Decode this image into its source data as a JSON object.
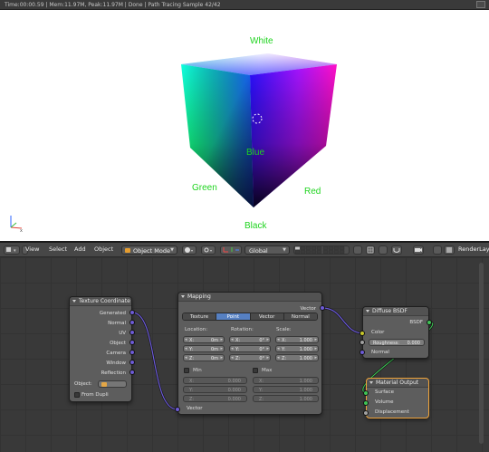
{
  "statusbar": {
    "text": "Time:00:00.59 | Mem:11.97M, Peak:11.97M | Done | Path Tracing Sample 42/42"
  },
  "viewport": {
    "labels": {
      "white": "White",
      "blue": "Blue",
      "green": "Green",
      "red": "Red",
      "black": "Black"
    },
    "label_color": "#1fd41f"
  },
  "header": {
    "menu": {
      "view": "View",
      "select": "Select",
      "add": "Add",
      "object": "Object"
    },
    "mode": "Object Mode",
    "orientation": "Global",
    "layer": "RenderLayer"
  },
  "nodes": {
    "texcoord": {
      "title": "Texture Coordinate",
      "outputs": [
        "Generated",
        "Normal",
        "UV",
        "Object",
        "Camera",
        "Window",
        "Reflection"
      ],
      "object_label": "Object:",
      "from_dupli": "From Dupli"
    },
    "mapping": {
      "title": "Mapping",
      "output": "Vector",
      "tabs": [
        "Texture",
        "Point",
        "Vector",
        "Normal"
      ],
      "active_tab": "Point",
      "location": {
        "label": "Location:",
        "x": "0m",
        "y": "0m",
        "z": "0m"
      },
      "rotation": {
        "label": "Rotation:",
        "x": "0°",
        "y": "0°",
        "z": "0°"
      },
      "scale": {
        "label": "Scale:",
        "x": "1.000",
        "y": "1.000",
        "z": "1.000"
      },
      "axis": {
        "x": "X:",
        "y": "Y:",
        "z": "Z:"
      },
      "min": {
        "label": "Min",
        "x": "0.000",
        "y": "0.000",
        "z": "0.000"
      },
      "max": {
        "label": "Max",
        "x": "1.000",
        "y": "1.000",
        "z": "1.000"
      },
      "input": "Vector"
    },
    "diffuse": {
      "title": "Diffuse BSDF",
      "output": "BSDF",
      "color": "Color",
      "roughness_label": "Roughness:",
      "roughness_value": "0.000",
      "normal": "Normal"
    },
    "output": {
      "title": "Material Output",
      "inputs": [
        "Surface",
        "Volume",
        "Displacement"
      ]
    }
  }
}
